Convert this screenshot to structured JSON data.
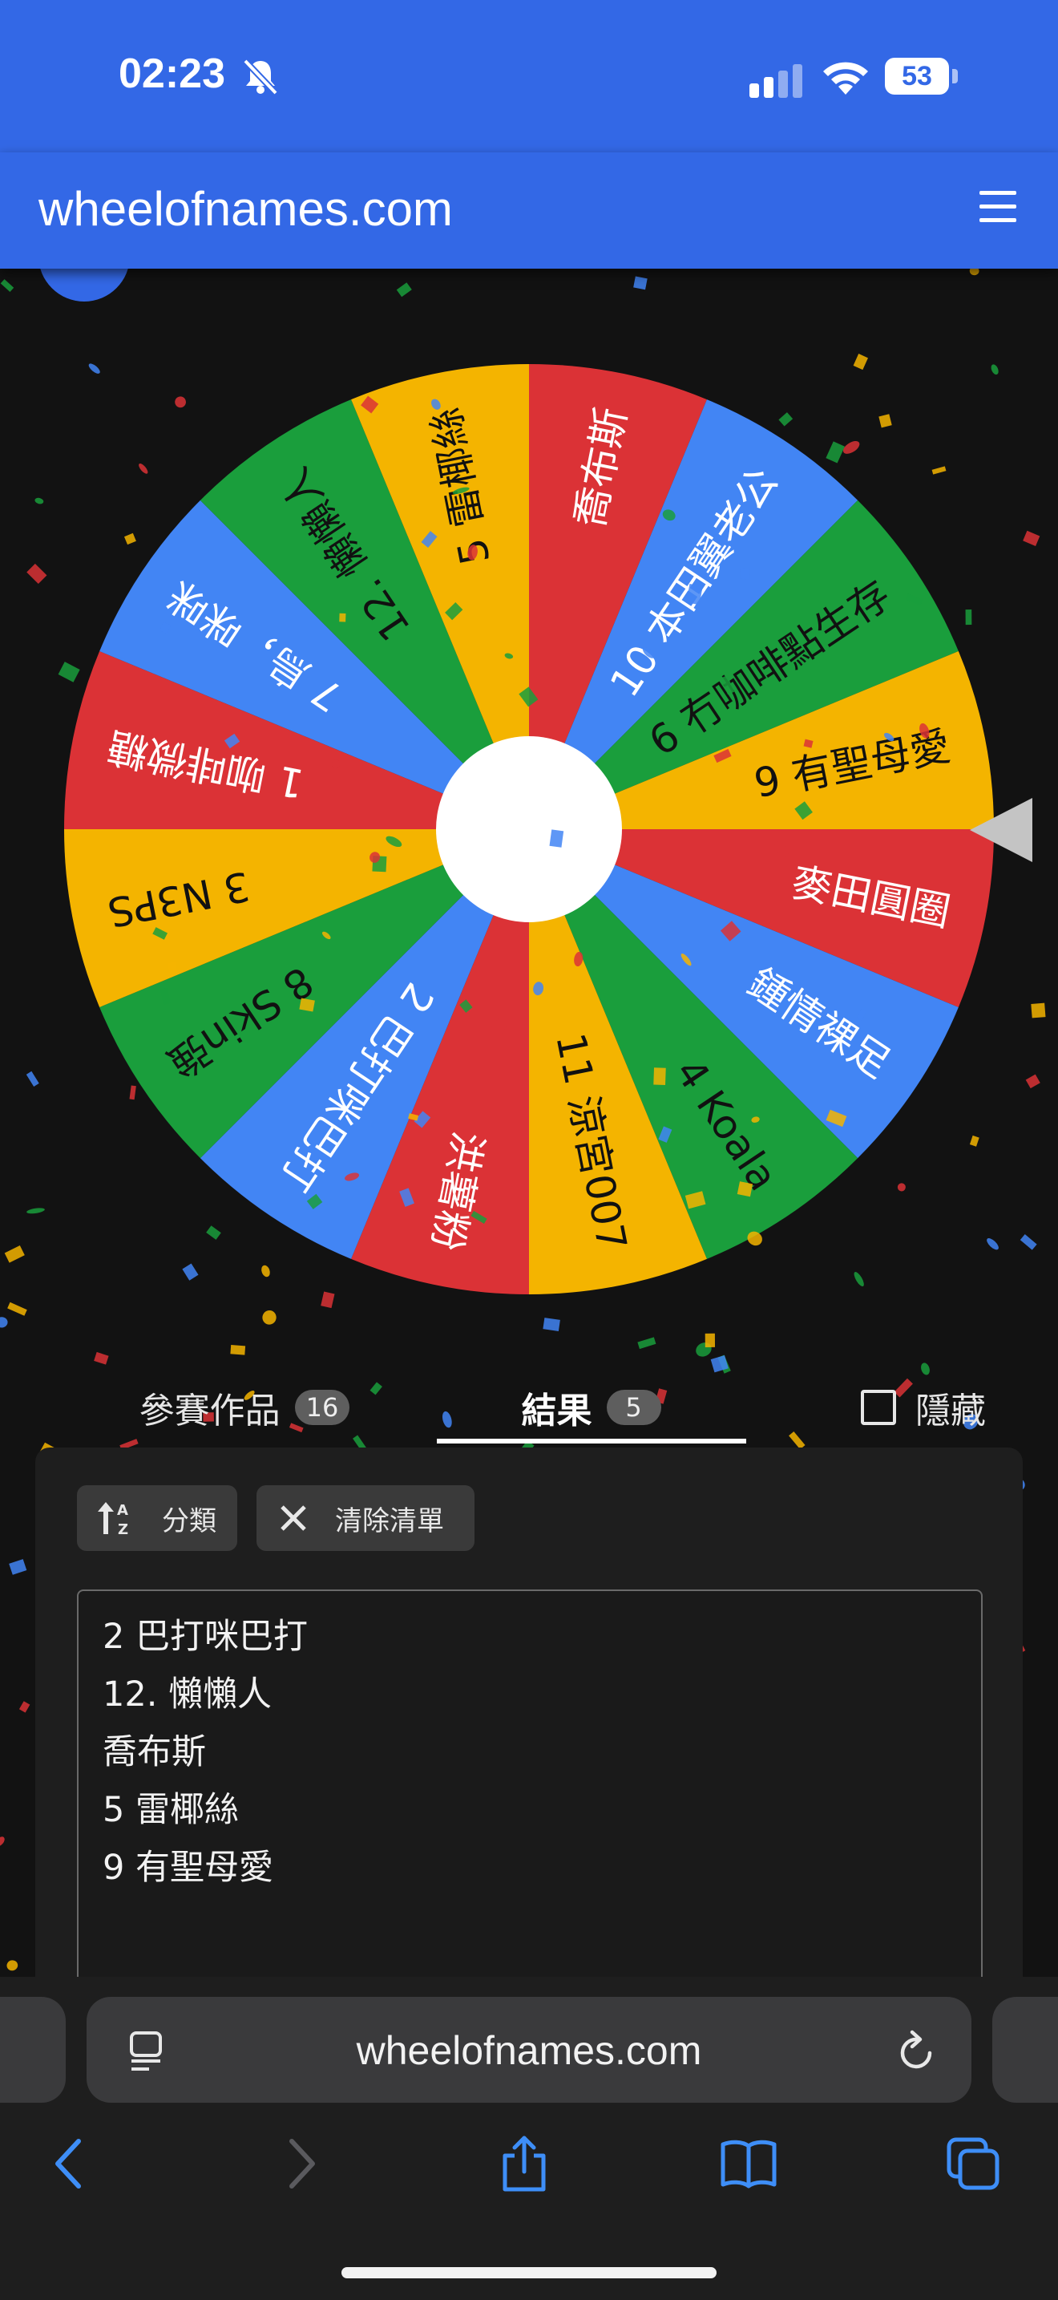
{
  "status_bar": {
    "time": "02:23",
    "battery": "53",
    "icons": [
      "bell-slash-icon",
      "signal-icon",
      "wifi-icon",
      "battery-icon"
    ]
  },
  "app_bar": {
    "site_title": "wheelofnames.com",
    "menu_icon": "hamburger-menu-icon"
  },
  "wheel": {
    "segments": [
      {
        "label": "喬布斯",
        "color": "#db3236"
      },
      {
        "label": "10 本田翼老公",
        "color": "#4285f4"
      },
      {
        "label": "6 冇咖啡點生存",
        "color": "#1a9e3c"
      },
      {
        "label": "9 有聖母愛",
        "color": "#f4b400"
      },
      {
        "label": "麥田圓圈",
        "color": "#db3236"
      },
      {
        "label": "鍾情裸足",
        "color": "#4285f4"
      },
      {
        "label": "4 Koala",
        "color": "#1a9e3c"
      },
      {
        "label": "11 涼宮007",
        "color": "#f4b400"
      },
      {
        "label": "洪薯粉",
        "color": "#db3236"
      },
      {
        "label": "2 巴打咪巴打",
        "color": "#4285f4"
      },
      {
        "label": "8 Skin強",
        "color": "#1a9e3c"
      },
      {
        "label": "3 N3PS",
        "color": "#f4b400"
      },
      {
        "label": "1 咖啡微糖",
        "color": "#db3236"
      },
      {
        "label": "7 烏，咪咪",
        "color": "#4285f4"
      },
      {
        "label": "12. 懶懶人",
        "color": "#1a9e3c"
      },
      {
        "label": "5 雷椰絲",
        "color": "#f4b400"
      }
    ],
    "text_colors": {
      "#db3236": "#ffffff",
      "#4285f4": "#ffffff",
      "#1a9e3c": "#111111",
      "#f4b400": "#111111"
    }
  },
  "tabs": [
    {
      "label": "參賽作品",
      "count": "16",
      "active": false
    },
    {
      "label": "結果",
      "count": "5",
      "active": true
    }
  ],
  "hide_toggle": {
    "label": "隱藏",
    "checked": false
  },
  "buttons": {
    "sort_label": "分類",
    "clear_label": "清除清單"
  },
  "results": [
    "2 巴打咪巴打",
    "12. 懶懶人",
    "喬布斯",
    "5 雷椰絲",
    "9 有聖母愛"
  ],
  "browser": {
    "url": "wheelofnames.com",
    "toolbar": [
      "back-icon",
      "forward-icon",
      "share-icon",
      "bookmarks-icon",
      "tabs-icon"
    ]
  }
}
